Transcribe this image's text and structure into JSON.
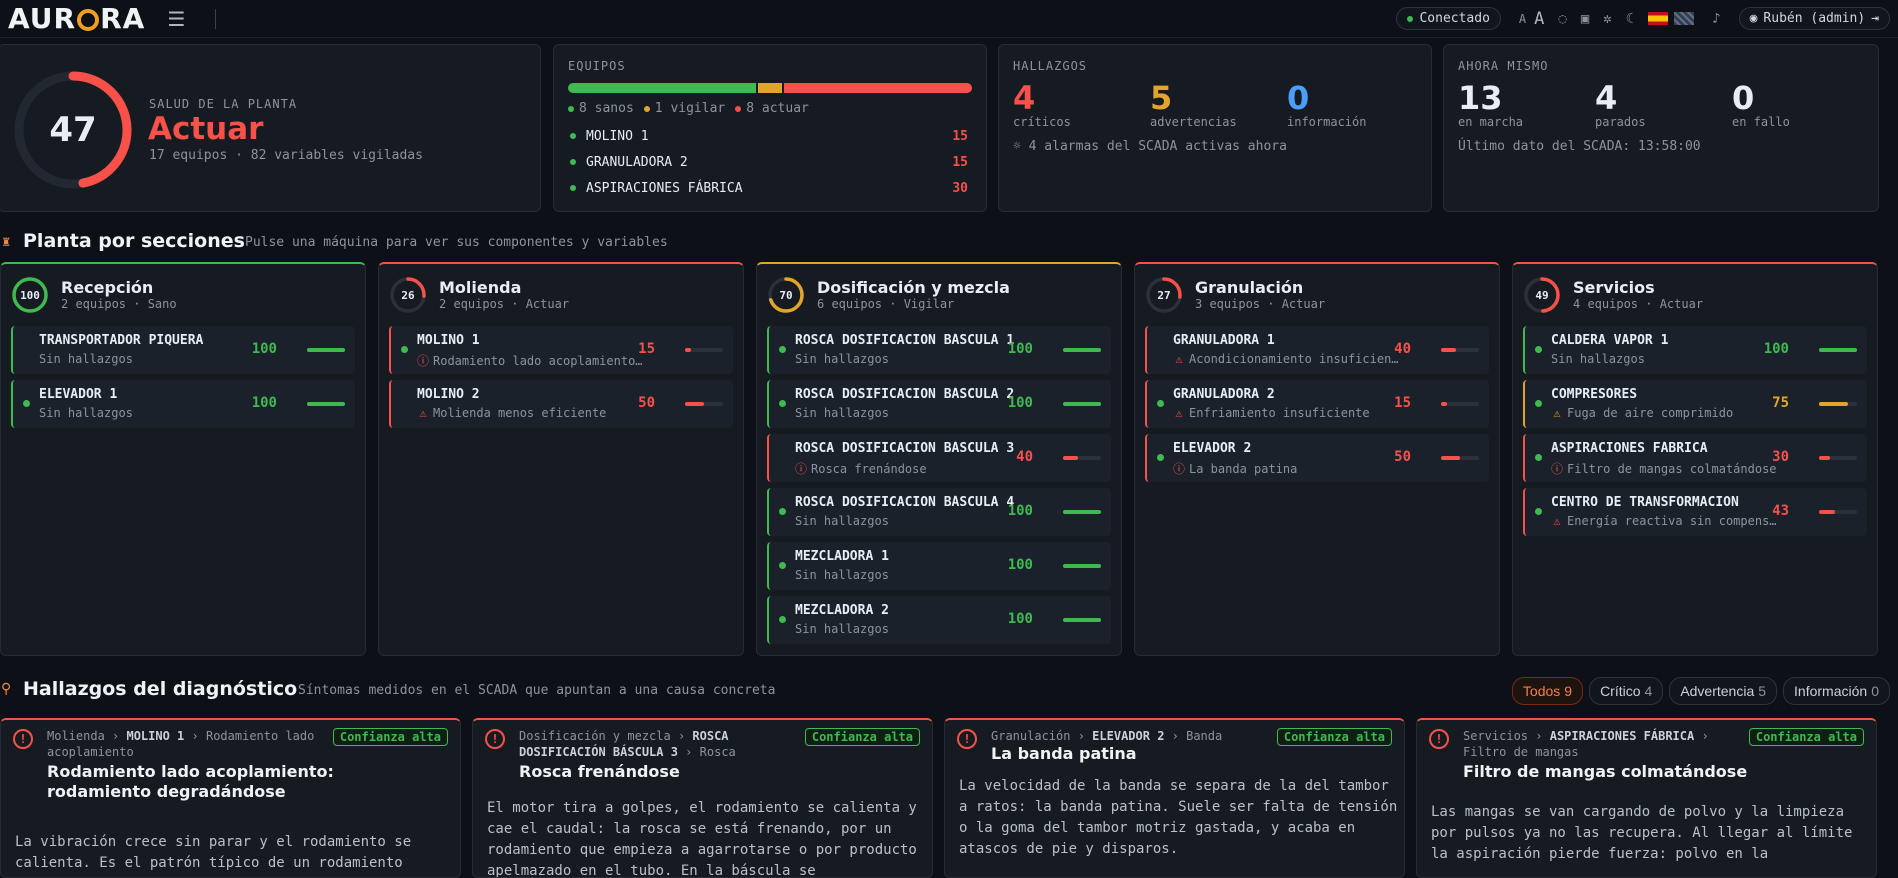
{
  "topbar": {
    "logo": "AURORA",
    "status": "Conectado",
    "font_small": "A",
    "font_large": "A",
    "user": "Rubén (admin)"
  },
  "health": {
    "score": "47",
    "label": "SALUD DE LA PLANTA",
    "status": "Actuar",
    "summary": "17 equipos · 82 variables vigiladas",
    "score_fraction": 0.47
  },
  "equipos": {
    "label": "EQUIPOS",
    "legend": [
      "8 sanos",
      "1 vigilar",
      "8 actuar"
    ],
    "counts": {
      "sanos": 8,
      "vigilar": 1,
      "actuar": 8
    },
    "top": [
      {
        "name": "MOLINO 1",
        "score": "15"
      },
      {
        "name": "GRANULADORA 2",
        "score": "15"
      },
      {
        "name": "ASPIRACIONES FÁBRICA",
        "score": "30"
      }
    ]
  },
  "hallazgos": {
    "label": "HALLAZGOS",
    "criticos": "4",
    "criticos_label": "críticos",
    "advertencias": "5",
    "advertencias_label": "advertencias",
    "informacion": "0",
    "informacion_label": "información",
    "alarms": "4 alarmas del SCADA activas ahora"
  },
  "ahora": {
    "label": "AHORA MISMO",
    "marcha": "13",
    "marcha_label": "en marcha",
    "parados": "4",
    "parados_label": "parados",
    "fallo": "0",
    "fallo_label": "en fallo",
    "last": "Último dato del SCADA: 13:58:00"
  },
  "sections_header": {
    "title": "Planta por secciones",
    "subtitle": "Pulse una máquina para ver sus componentes y variables"
  },
  "sections": [
    {
      "name": "Recepción",
      "score": "100",
      "meta": "2 equipos · Sano",
      "color": "#3fb950",
      "items": [
        {
          "name": "TRANSPORTADOR PIQUERA",
          "sub": "Sin hallazgos",
          "score": "100",
          "level": 1.0,
          "state": "ok",
          "dot": false
        },
        {
          "name": "ELEVADOR 1",
          "sub": "Sin hallazgos",
          "score": "100",
          "level": 1.0,
          "state": "ok",
          "dot": true
        }
      ]
    },
    {
      "name": "Molienda",
      "score": "26",
      "meta": "2 equipos · Actuar",
      "color": "#f85149",
      "items": [
        {
          "name": "MOLINO 1",
          "sub": "Rodamiento lado acoplamiento degradándose",
          "score": "15",
          "level": 0.15,
          "state": "crit",
          "dot": true,
          "icon": "crit"
        },
        {
          "name": "MOLINO 2",
          "sub": "Molienda menos eficiente",
          "score": "50",
          "level": 0.5,
          "state": "crit",
          "dot": false,
          "icon": "warn"
        }
      ]
    },
    {
      "name": "Dosificación y mezcla",
      "score": "70",
      "meta": "6 equipos · Vigilar",
      "color": "#e3a42b",
      "items": [
        {
          "name": "ROSCA DOSIFICACIÓN BÁSCULA 1",
          "sub": "Sin hallazgos",
          "score": "100",
          "level": 1.0,
          "state": "ok",
          "dot": true
        },
        {
          "name": "ROSCA DOSIFICACIÓN BÁSCULA 2",
          "sub": "Sin hallazgos",
          "score": "100",
          "level": 1.0,
          "state": "ok",
          "dot": true
        },
        {
          "name": "ROSCA DOSIFICACIÓN BÁSCULA 3",
          "sub": "Rosca frenándose",
          "score": "40",
          "level": 0.4,
          "state": "crit",
          "dot": false,
          "icon": "crit"
        },
        {
          "name": "ROSCA DOSIFICACIÓN BÁSCULA 4",
          "sub": "Sin hallazgos",
          "score": "100",
          "level": 1.0,
          "state": "ok",
          "dot": true
        },
        {
          "name": "MEZCLADORA 1",
          "sub": "Sin hallazgos",
          "score": "100",
          "level": 1.0,
          "state": "ok",
          "dot": true
        },
        {
          "name": "MEZCLADORA 2",
          "sub": "Sin hallazgos",
          "score": "100",
          "level": 1.0,
          "state": "ok",
          "dot": true
        }
      ]
    },
    {
      "name": "Granulación",
      "score": "27",
      "meta": "3 equipos · Actuar",
      "color": "#f85149",
      "items": [
        {
          "name": "GRANULADORA 1",
          "sub": "Acondicionamiento insuficiente",
          "score": "40",
          "level": 0.4,
          "state": "crit",
          "dot": false,
          "icon": "warn"
        },
        {
          "name": "GRANULADORA 2",
          "sub": "Enfriamiento insuficiente",
          "score": "15",
          "level": 0.15,
          "state": "crit",
          "dot": true,
          "icon": "warn"
        },
        {
          "name": "ELEVADOR 2",
          "sub": "La banda patina",
          "score": "50",
          "level": 0.5,
          "state": "crit",
          "dot": true,
          "icon": "crit"
        }
      ]
    },
    {
      "name": "Servicios",
      "score": "49",
      "meta": "4 equipos · Actuar",
      "color": "#f85149",
      "items": [
        {
          "name": "CALDERA VAPOR 1",
          "sub": "Sin hallazgos",
          "score": "100",
          "level": 1.0,
          "state": "ok",
          "dot": true
        },
        {
          "name": "COMPRESORES",
          "sub": "Fuga de aire comprimido",
          "score": "75",
          "level": 0.75,
          "state": "warn",
          "dot": true,
          "icon": "warn"
        },
        {
          "name": "ASPIRACIONES FÁBRICA",
          "sub": "Filtro de mangas colmatándose",
          "score": "30",
          "level": 0.3,
          "state": "crit",
          "dot": true,
          "icon": "crit"
        },
        {
          "name": "CENTRO DE TRANSFORMACIÓN",
          "sub": "Energía reactiva sin compensar",
          "score": "43",
          "level": 0.43,
          "state": "crit",
          "dot": true,
          "icon": "warn"
        }
      ]
    }
  ],
  "findings_header": {
    "title": "Hallazgos del diagnóstico",
    "subtitle": "Síntomas medidos en el SCADA que apuntan a una causa concreta"
  },
  "filters": [
    {
      "label": "Todos",
      "count": "9"
    },
    {
      "label": "Crítico",
      "count": "4"
    },
    {
      "label": "Advertencia",
      "count": "5"
    },
    {
      "label": "Información",
      "count": "0"
    }
  ],
  "findings": [
    {
      "section": "Molienda",
      "machine": "MOLINO 1",
      "component": "Rodamiento lado acoplamiento",
      "confidence": "Confianza alta",
      "title": "Rodamiento lado acoplamiento: rodamiento degradándose",
      "desc": "La vibración crece sin parar y el rodamiento se calienta. Es el patrón típico de un rodamiento"
    },
    {
      "section": "Dosificación y mezcla",
      "machine": "ROSCA DOSIFICACIÓN BÁSCULA 3",
      "component": "Rosca",
      "confidence": "Confianza alta",
      "title": "Rosca frenándose",
      "desc": "El motor tira a golpes, el rodamiento se calienta y cae el caudal: la rosca se está frenando, por un rodamiento que empieza a agarrotarse o por producto apelmazado en el tubo. En la báscula se"
    },
    {
      "section": "Granulación",
      "machine": "ELEVADOR 2",
      "component": "Banda",
      "confidence": "Confianza alta",
      "title": "La banda patina",
      "desc": "La velocidad de la banda se separa de la del tambor a ratos: la banda patina. Suele ser falta de tensión o la goma del tambor motriz gastada, y acaba en atascos de pie y disparos."
    },
    {
      "section": "Servicios",
      "machine": "ASPIRACIONES FÁBRICA",
      "component": "Filtro de mangas",
      "confidence": "Confianza alta",
      "title": "Filtro de mangas colmatándose",
      "desc": "Las mangas se van cargando de polvo y la limpieza por pulsos ya no las recupera. Al llegar al límite la aspiración pierde fuerza: polvo en la"
    }
  ]
}
